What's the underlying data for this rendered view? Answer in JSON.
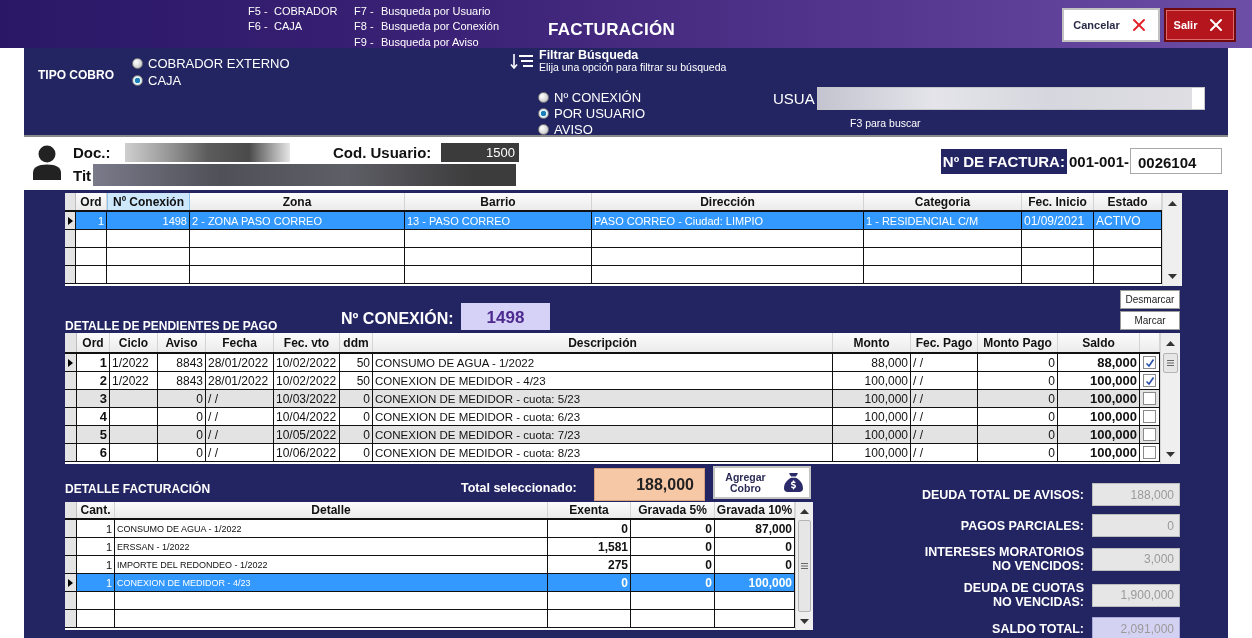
{
  "header": {
    "shortcuts": [
      [
        {
          "key": "F5 -",
          "label": "COBRADOR"
        },
        {
          "key": "F6 -",
          "label": "CAJA"
        }
      ],
      [
        {
          "key": "F7 -",
          "label": "Busqueda por Usuario"
        },
        {
          "key": "F8 -",
          "label": "Busqueda por Conexión"
        },
        {
          "key": "F9 -",
          "label": "Busqueda por Aviso"
        }
      ]
    ],
    "title": "FACTURACIÓN",
    "buttons": [
      {
        "label": "Cancelar",
        "kind": "cancel"
      },
      {
        "label": "Salir",
        "kind": "exit"
      }
    ]
  },
  "tipo_cobro": {
    "label": "TIPO COBRO",
    "options": [
      {
        "label": "COBRADOR EXTERNO",
        "selected": false
      },
      {
        "label": "CAJA",
        "selected": true
      }
    ]
  },
  "filtro": {
    "title": "Filtrar Búsqueda",
    "subtitle": "Elija una opción para filtrar su búsqueda",
    "options": [
      {
        "label": "Nº CONEXIÓN",
        "selected": false
      },
      {
        "label": "POR USUARIO",
        "selected": true
      },
      {
        "label": "AVISO",
        "selected": false
      }
    ],
    "search_label": "USUA",
    "hint": "F3 para buscar"
  },
  "cliente": {
    "doc_label": "Doc.:",
    "codigo_label": "Cod. Usuario:",
    "codigo": "1500",
    "titular_label": "Tit"
  },
  "factura": {
    "label": "Nº DE FACTURA:",
    "prefix": "001-001-",
    "number": "0026104"
  },
  "conexiones": {
    "columns": [
      {
        "label": "Ord",
        "selected": false
      },
      {
        "label": "Nº Conexión",
        "selected": true
      },
      {
        "label": "Zona",
        "selected": false
      },
      {
        "label": "Barrio",
        "selected": false
      },
      {
        "label": "Dirección",
        "selected": false
      },
      {
        "label": "Categoria",
        "selected": false
      },
      {
        "label": "Fec. Inicio",
        "selected": false
      },
      {
        "label": "Estado",
        "selected": false
      }
    ],
    "rows": [
      {
        "cells": [
          "1",
          "1498",
          "2 - ZONA PASO CORREO",
          "13 - PASO CORREO",
          "PASO CORREO - Ciudad: LIMPIO",
          "1 - RESIDENCIAL C/M",
          "01/09/2021",
          "ACTIVO"
        ],
        "selected": true,
        "current": true
      }
    ]
  },
  "pendientes": {
    "title": "DETALLE DE PENDIENTES DE PAGO",
    "conexion_label": "Nº CONEXIÓN:",
    "conexion": "1498",
    "buttons": [
      "Desmarcar",
      "Marcar"
    ],
    "columns": [
      "Ord",
      "Ciclo",
      "Aviso",
      "Fecha",
      "Fec. vto",
      "ddm",
      "Descripción",
      "Monto",
      "Fec. Pago",
      "Monto Pago",
      "Saldo"
    ],
    "rows": [
      {
        "cells": [
          "1",
          "1/2022",
          "8843",
          "28/01/2022",
          "10/02/2022",
          "50",
          "CONSUMO DE AGUA - 1/2022",
          "88,000",
          "/ /",
          "0",
          "88,000"
        ],
        "checked": true,
        "shaded": false,
        "selected": false,
        "current": true
      },
      {
        "cells": [
          "2",
          "1/2022",
          "8843",
          "28/01/2022",
          "10/02/2022",
          "50",
          "CONEXION DE MEDIDOR - 4/23",
          "100,000",
          "/ /",
          "0",
          "100,000"
        ],
        "checked": true,
        "shaded": false,
        "selected": false,
        "current": false
      },
      {
        "cells": [
          "3",
          null,
          "0",
          "/ /",
          "10/03/2022",
          "0",
          "CONEXION DE MEDIDOR - cuota: 5/23",
          "100,000",
          "/ /",
          "0",
          "100,000"
        ],
        "checked": false,
        "shaded": true,
        "selected": false,
        "current": false
      },
      {
        "cells": [
          "4",
          null,
          "0",
          "/ /",
          "10/04/2022",
          "0",
          "CONEXION DE MEDIDOR - cuota: 6/23",
          "100,000",
          "/ /",
          "0",
          "100,000"
        ],
        "checked": false,
        "shaded": false,
        "selected": false,
        "current": false
      },
      {
        "cells": [
          "5",
          null,
          "0",
          "/ /",
          "10/05/2022",
          "0",
          "CONEXION DE MEDIDOR - cuota: 7/23",
          "100,000",
          "/ /",
          "0",
          "100,000"
        ],
        "checked": false,
        "shaded": true,
        "selected": false,
        "current": false
      },
      {
        "cells": [
          "6",
          null,
          "0",
          "/ /",
          "10/06/2022",
          "0",
          "CONEXION DE MEDIDOR - cuota: 8/23",
          "100,000",
          "/ /",
          "0",
          "100,000"
        ],
        "checked": false,
        "shaded": false,
        "selected": false,
        "current": false
      }
    ]
  },
  "facturacion": {
    "title": "DETALLE FACTURACIÓN",
    "total_label": "Total seleccionado:",
    "total": "188,000",
    "add_button": "Agregar Cobro",
    "columns": [
      "Cant.",
      "Detalle",
      "Exenta",
      "Gravada 5%",
      "Gravada 10%"
    ],
    "rows": [
      {
        "cells": [
          "1",
          "CONSUMO DE AGUA - 1/2022",
          "0",
          "0",
          "87,000"
        ],
        "selected": false,
        "current": false
      },
      {
        "cells": [
          "1",
          "ERSSAN - 1/2022",
          "1,581",
          "0",
          "0"
        ],
        "selected": false,
        "current": false
      },
      {
        "cells": [
          "1",
          "IMPORTE DEL REDONDEO - 1/2022",
          "275",
          "0",
          "0"
        ],
        "selected": false,
        "current": false
      },
      {
        "cells": [
          "1",
          "CONEXION DE MEDIDOR - 4/23",
          "0",
          "0",
          "100,000"
        ],
        "selected": true,
        "current": true
      }
    ]
  },
  "resumen": [
    {
      "label": "DEUDA TOTAL DE AVISOS:",
      "value": "188,000",
      "highlighted": false
    },
    {
      "label": "PAGOS PARCIALES:",
      "value": "0",
      "highlighted": false
    },
    {
      "label": "INTERESES MORATORIOS\nNO VENCIDOS:",
      "value": "3,000",
      "highlighted": false
    },
    {
      "label": "DEUDA DE CUOTAS\nNO VENCIDAS:",
      "value": "1,900,000",
      "highlighted": false
    },
    {
      "label": "SALDO TOTAL:",
      "value": "2,091,000",
      "highlighted": true
    }
  ]
}
